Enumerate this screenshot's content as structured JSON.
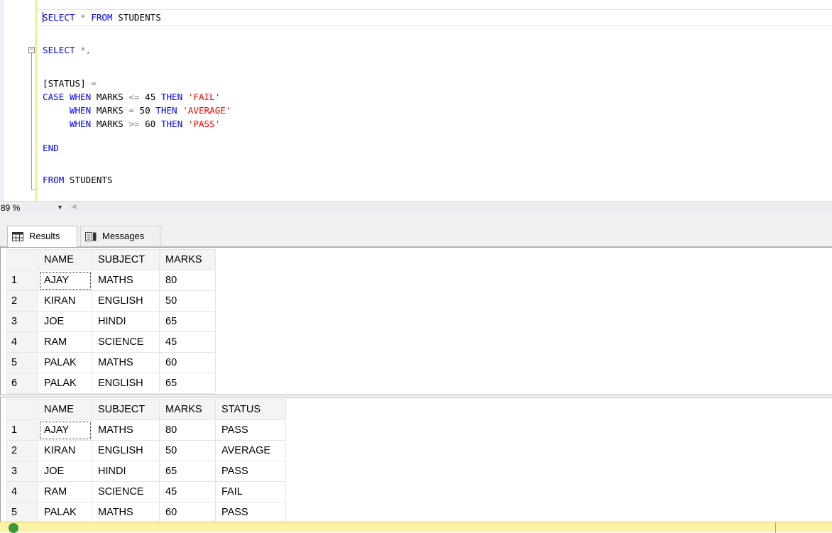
{
  "editor": {
    "lines": [
      [
        {
          "t": "SELECT",
          "c": "kw"
        },
        {
          "t": " * ",
          "c": "op"
        },
        {
          "t": "FROM",
          "c": "kw"
        },
        {
          "t": " STUDENTS",
          "c": "plain"
        }
      ],
      [
        {
          "t": "SELECT",
          "c": "kw"
        },
        {
          "t": " *,",
          "c": "op"
        }
      ],
      [
        {
          "t": "[STATUS]",
          "c": "plain"
        },
        {
          "t": " =",
          "c": "op"
        }
      ],
      [
        {
          "t": "CASE",
          "c": "kw"
        },
        {
          "t": " ",
          "c": "plain"
        },
        {
          "t": "WHEN",
          "c": "kw"
        },
        {
          "t": " MARKS ",
          "c": "plain"
        },
        {
          "t": "<=",
          "c": "op"
        },
        {
          "t": " 45 ",
          "c": "plain"
        },
        {
          "t": "THEN",
          "c": "kw"
        },
        {
          "t": " ",
          "c": "plain"
        },
        {
          "t": "'FAIL'",
          "c": "str"
        }
      ],
      [
        {
          "t": "     ",
          "c": "plain"
        },
        {
          "t": "WHEN",
          "c": "kw"
        },
        {
          "t": " MARKS ",
          "c": "plain"
        },
        {
          "t": "=",
          "c": "op"
        },
        {
          "t": " 50 ",
          "c": "plain"
        },
        {
          "t": "THEN",
          "c": "kw"
        },
        {
          "t": " ",
          "c": "plain"
        },
        {
          "t": "'AVERAGE'",
          "c": "str"
        }
      ],
      [
        {
          "t": "     ",
          "c": "plain"
        },
        {
          "t": "WHEN",
          "c": "kw"
        },
        {
          "t": " MARKS ",
          "c": "plain"
        },
        {
          "t": ">=",
          "c": "op"
        },
        {
          "t": " 60 ",
          "c": "plain"
        },
        {
          "t": "THEN",
          "c": "kw"
        },
        {
          "t": " ",
          "c": "plain"
        },
        {
          "t": "'PASS'",
          "c": "str"
        }
      ],
      [
        {
          "t": "END",
          "c": "kw"
        }
      ],
      [
        {
          "t": "FROM",
          "c": "kw"
        },
        {
          "t": " STUDENTS",
          "c": "plain"
        }
      ]
    ]
  },
  "zoom": {
    "level": "89 %"
  },
  "tabs": {
    "results_label": "Results",
    "messages_label": "Messages"
  },
  "grid1": {
    "columns": [
      "NAME",
      "SUBJECT",
      "MARKS"
    ],
    "rows": [
      [
        "1",
        "AJAY",
        "MATHS",
        "80"
      ],
      [
        "2",
        "KIRAN",
        "ENGLISH",
        "50"
      ],
      [
        "3",
        "JOE",
        "HINDI",
        "65"
      ],
      [
        "4",
        "RAM",
        "SCIENCE",
        "45"
      ],
      [
        "5",
        "PALAK",
        "MATHS",
        "60"
      ],
      [
        "6",
        "PALAK",
        "ENGLISH",
        "65"
      ]
    ]
  },
  "grid2": {
    "columns": [
      "NAME",
      "SUBJECT",
      "MARKS",
      "STATUS"
    ],
    "rows": [
      [
        "1",
        "AJAY",
        "MATHS",
        "80",
        "PASS"
      ],
      [
        "2",
        "KIRAN",
        "ENGLISH",
        "50",
        "AVERAGE"
      ],
      [
        "3",
        "JOE",
        "HINDI",
        "65",
        "PASS"
      ],
      [
        "4",
        "RAM",
        "SCIENCE",
        "45",
        "FAIL"
      ],
      [
        "5",
        "PALAK",
        "MATHS",
        "60",
        "PASS"
      ]
    ]
  },
  "status": {
    "icon": "success-check-icon"
  },
  "colors": {
    "keyword": "#0000ff",
    "operator": "#808080",
    "string": "#ff0000",
    "status_bar": "#fdf2a6",
    "status_icon": "#3a9a3a"
  }
}
